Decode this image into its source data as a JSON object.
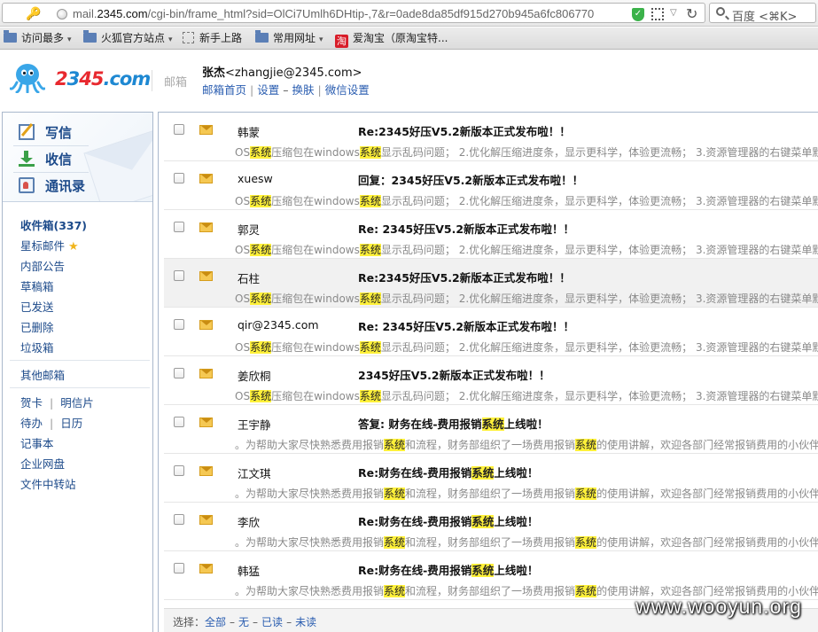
{
  "browser": {
    "url_prefix": "mail.",
    "url_domain": "2345.com",
    "url_rest": "/cgi-bin/frame_html?sid=OlCi7Umlh6DHtip-,7&r=0ade8da85df915d270b945a6fc806770",
    "search_placeholder": "百度 <⌘K>",
    "bookmarks": [
      {
        "label": "访问最多",
        "caret": "▾"
      },
      {
        "label": "火狐官方站点",
        "caret": "▾"
      },
      {
        "label": "新手上路"
      },
      {
        "label": "常用网址",
        "caret": "▾"
      },
      {
        "label": "爱淘宝（原淘宝特..."
      }
    ]
  },
  "header": {
    "logo_red": "2",
    "logo_blue1": "3",
    "logo_red2": "45",
    "logo_blue2": ".com",
    "product": "邮箱",
    "user_name": "张杰",
    "user_email": "<zhangjie@2345.com>",
    "links": [
      "邮箱首页",
      "设置",
      "换肤",
      "微信设置"
    ]
  },
  "sidebar": {
    "actions": [
      "写信",
      "收信",
      "通讯录"
    ],
    "folders": {
      "inbox": "收件箱(337)",
      "starred": "星标邮件",
      "notice": "内部公告",
      "drafts": "草稿箱",
      "sent": "已发送",
      "deleted": "已删除",
      "junk": "垃圾箱",
      "other": "其他邮箱",
      "card": "贺卡",
      "postcard": "明信片",
      "todo": "待办",
      "calendar": "日历",
      "notes": "记事本",
      "netdisk": "企业网盘",
      "transfer": "文件中转站"
    }
  },
  "emails": [
    {
      "sender": "韩蒙",
      "subject": "Re:2345好压V5.2新版本正式发布啦！！",
      "p1": "OS",
      "p2": "系统",
      "p3": "压缩包在windows",
      "p4": "系统",
      "p5": "显示乱码问题； 2.优化解压缩进度条，显示更科学，体验更流畅； 3.资源管理器的右键菜单默"
    },
    {
      "sender": "xuesw",
      "subject": "回复：2345好压V5.2新版本正式发布啦！！",
      "p1": "OS",
      "p2": "系统",
      "p3": "压缩包在windows",
      "p4": "系统",
      "p5": "显示乱码问题； 2.优化解压缩进度条，显示更科学，体验更流畅； 3.资源管理器的右键菜单默"
    },
    {
      "sender": "郭灵",
      "subject": "Re: 2345好压V5.2新版本正式发布啦！！",
      "p1": "OS",
      "p2": "系统",
      "p3": "压缩包在windows",
      "p4": "系统",
      "p5": "显示乱码问题； 2.优化解压缩进度条，显示更科学，体验更流畅； 3.资源管理器的右键菜单默"
    },
    {
      "sender": "石柱",
      "subject": "Re:2345好压V5.2新版本正式发布啦！！",
      "p1": "OS",
      "p2": "系统",
      "p3": "压缩包在windows",
      "p4": "系统",
      "p5": "显示乱码问题； 2.优化解压缩进度条，显示更科学，体验更流畅； 3.资源管理器的右键菜单默"
    },
    {
      "sender": "qir@2345.com",
      "subject": "Re: 2345好压V5.2新版本正式发布啦！！",
      "p1": "OS",
      "p2": "系统",
      "p3": "压缩包在windows",
      "p4": "系统",
      "p5": "显示乱码问题； 2.优化解压缩进度条，显示更科学，体验更流畅； 3.资源管理器的右键菜单默"
    },
    {
      "sender": "姜欣桐",
      "subject": "2345好压V5.2新版本正式发布啦！！",
      "p1": "OS",
      "p2": "系统",
      "p3": "压缩包在windows",
      "p4": "系统",
      "p5": "显示乱码问题； 2.优化解压缩进度条，显示更科学，体验更流畅； 3.资源管理器的右键菜单默"
    },
    {
      "sender": "王宇静",
      "subject_a": "答复: 财务在线-费用报销",
      "subject_hl": "系统",
      "subject_b": "上线啦！",
      "p1": "。为帮助大家尽快熟悉费用报销",
      "p2": "系统",
      "p3": "和流程，财务部组织了一场费用报销",
      "p4": "系统",
      "p5": "的使用讲解，欢迎各部门经常报销费用的小伙伴"
    },
    {
      "sender": "江文琪",
      "subject_a": "Re:财务在线-费用报销",
      "subject_hl": "系统",
      "subject_b": "上线啦！",
      "p1": "。为帮助大家尽快熟悉费用报销",
      "p2": "系统",
      "p3": "和流程，财务部组织了一场费用报销",
      "p4": "系统",
      "p5": "的使用讲解，欢迎各部门经常报销费用的小伙伴"
    },
    {
      "sender": "李欣",
      "subject_a": "Re:财务在线-费用报销",
      "subject_hl": "系统",
      "subject_b": "上线啦！",
      "p1": "。为帮助大家尽快熟悉费用报销",
      "p2": "系统",
      "p3": "和流程，财务部组织了一场费用报销",
      "p4": "系统",
      "p5": "的使用讲解，欢迎各部门经常报销费用的小伙伴"
    },
    {
      "sender": "韩猛",
      "subject_a": "Re:财务在线-费用报销",
      "subject_hl": "系统",
      "subject_b": "上线啦！",
      "p1": "。为帮助大家尽快熟悉费用报销",
      "p2": "系统",
      "p3": "和流程，财务部组织了一场费用报销",
      "p4": "系统",
      "p5": "的使用讲解，欢迎各部门经常报销费用的小伙伴"
    }
  ],
  "footer": {
    "label": "选择：",
    "options": [
      "全部",
      "无",
      "已读",
      "未读"
    ]
  },
  "watermark": "www.wooyun.org",
  "colors": {
    "highlight": "#fff13a",
    "link": "#2a5db0",
    "sidebar_text": "#1c4a8a"
  }
}
